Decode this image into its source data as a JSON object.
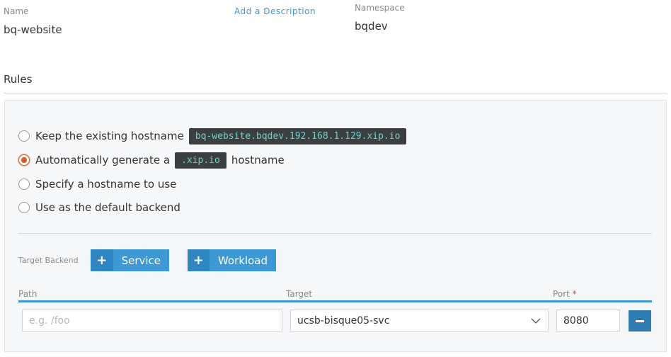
{
  "header": {
    "name_label": "Name",
    "name_value": "bq-website",
    "add_description": "Add a Description",
    "namespace_label": "Namespace",
    "namespace_value": "bqdev"
  },
  "rules": {
    "title": "Rules",
    "options": [
      {
        "prefix": "Keep the existing hostname",
        "code": "bq-website.bqdev.192.168.1.129.xip.io",
        "suffix": "",
        "checked": false
      },
      {
        "prefix": "Automatically generate a",
        "code": ".xip.io",
        "suffix": "hostname",
        "checked": true
      },
      {
        "prefix": "Specify a hostname to use",
        "code": "",
        "suffix": "",
        "checked": false
      },
      {
        "prefix": "Use as the default backend",
        "code": "",
        "suffix": "",
        "checked": false
      }
    ],
    "target_backend_label": "Target Backend",
    "service_button": "Service",
    "workload_button": "Workload",
    "columns": {
      "path": "Path",
      "target": "Target",
      "port": "Port",
      "required_mark": "*"
    },
    "row": {
      "path_placeholder": "e.g. /foo",
      "path_value": "",
      "target_value": "ucsb-bisque05-svc",
      "port_value": "8080"
    }
  },
  "colors": {
    "accent": "#3d98d3",
    "radio_checked": "#e0552a",
    "code_bg": "#3b3f42",
    "code_text": "#6fd0c8"
  }
}
